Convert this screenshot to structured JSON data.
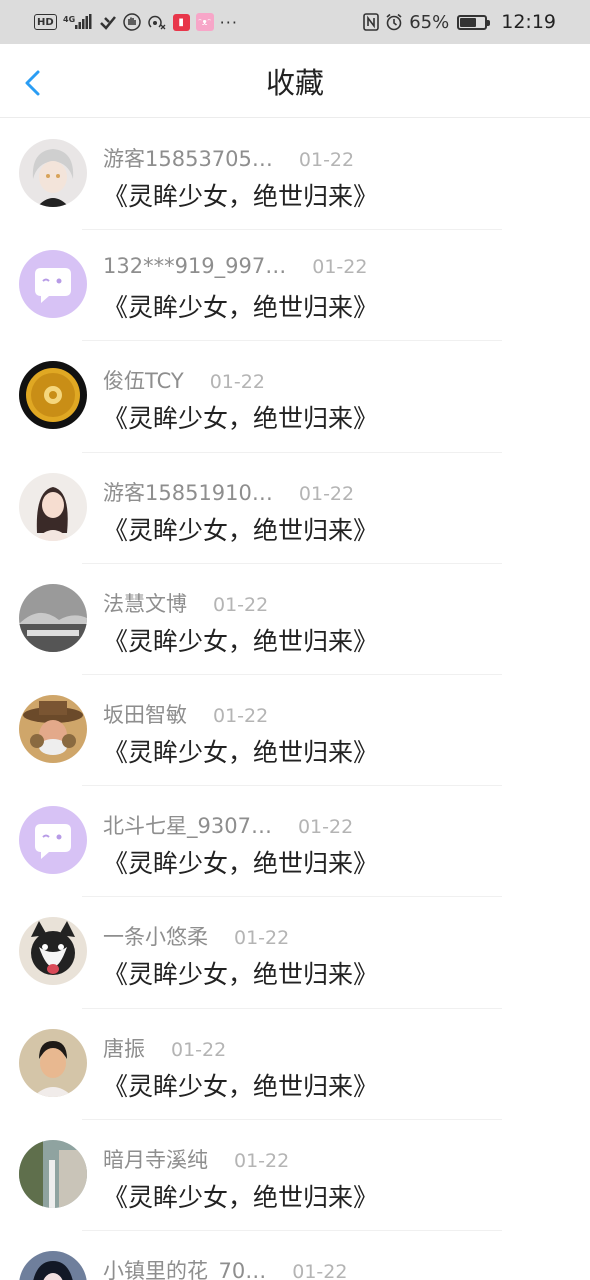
{
  "status_bar": {
    "hd": "HD",
    "network": "4G",
    "battery_text": "65%",
    "battery_level": 0.65,
    "time": "12:19",
    "more": "···"
  },
  "header": {
    "title": "收藏"
  },
  "items": [
    {
      "name": "游客15853705…",
      "date": "01-22",
      "book": "《灵眸少女，绝世归来》",
      "avatar": "anime-boy"
    },
    {
      "name": "132***919_997…",
      "date": "01-22",
      "book": "《灵眸少女，绝世归来》",
      "avatar": "default-chat"
    },
    {
      "name": "俊伍TCY",
      "date": "01-22",
      "book": "《灵眸少女，绝世归来》",
      "avatar": "gold-coin"
    },
    {
      "name": "游客15851910…",
      "date": "01-22",
      "book": "《灵眸少女，绝世归来》",
      "avatar": "woman-photo"
    },
    {
      "name": "法慧文博",
      "date": "01-22",
      "book": "《灵眸少女，绝世归来》",
      "avatar": "gray-landscape"
    },
    {
      "name": "坂田智敏",
      "date": "01-22",
      "book": "《灵眸少女，绝世归来》",
      "avatar": "hat-man"
    },
    {
      "name": "北斗七星_9307…",
      "date": "01-22",
      "book": "《灵眸少女，绝世归来》",
      "avatar": "default-chat"
    },
    {
      "name": "一条小悠柔",
      "date": "01-22",
      "book": "《灵眸少女，绝世归来》",
      "avatar": "husky-dog"
    },
    {
      "name": "唐振",
      "date": "01-22",
      "book": "《灵眸少女，绝世归来》",
      "avatar": "boy-photo"
    },
    {
      "name": "暗月寺溪纯",
      "date": "01-22",
      "book": "《灵眸少女，绝世归来》",
      "avatar": "street-photo"
    },
    {
      "name": "小镇里的花_70…",
      "date": "01-22",
      "book": "",
      "avatar": "girl-dark"
    }
  ]
}
